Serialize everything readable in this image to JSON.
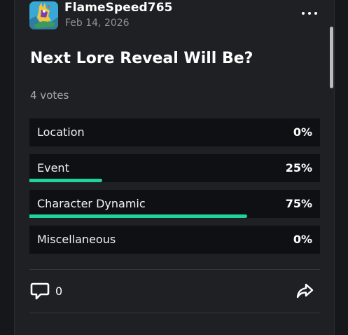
{
  "post": {
    "username": "FlameSpeed765",
    "date": "Feb 14, 2026",
    "title": "Next Lore Reveal Will Be?",
    "votes": "4 votes"
  },
  "poll": {
    "options": [
      {
        "label": "Location",
        "percent": "0%",
        "fraction": 0
      },
      {
        "label": "Event",
        "percent": "25%",
        "fraction": 0.25
      },
      {
        "label": "Character Dynamic",
        "percent": "75%",
        "fraction": 0.75
      },
      {
        "label": "Miscellaneous",
        "percent": "0%",
        "fraction": 0
      }
    ]
  },
  "actions": {
    "comment_count": "0"
  },
  "icons": {
    "more": "more-icon",
    "comment": "comment-icon",
    "share": "share-icon"
  },
  "colors": {
    "bar": "#1fd39b",
    "background": "#1f2023",
    "option_background": "#0f1013"
  }
}
